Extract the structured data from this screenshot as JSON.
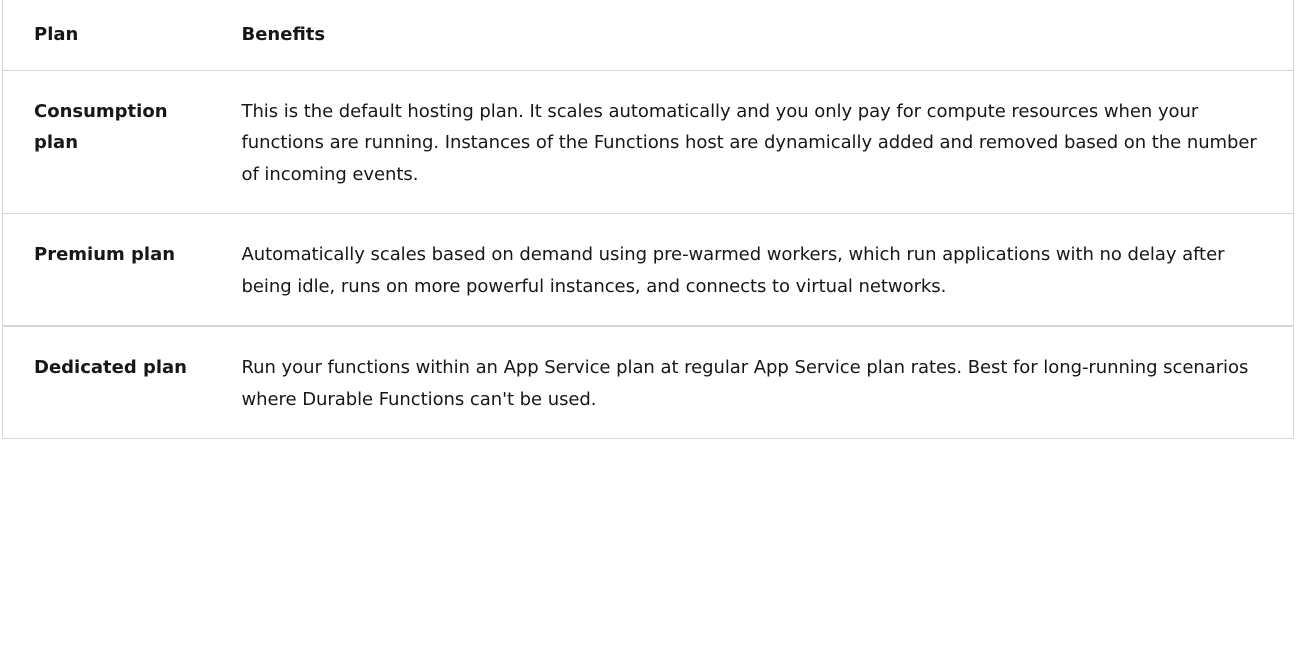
{
  "table": {
    "headers": {
      "plan": "Plan",
      "benefits": "Benefits"
    },
    "rows": [
      {
        "plan": "Consumption plan",
        "benefits": "This is the default hosting plan. It scales automatically and you only pay for compute resources when your functions are running. Instances of the Functions host are dynamically added and removed based on the number of incoming events."
      },
      {
        "plan": "Premium plan",
        "benefits": "Automatically scales based on demand using pre-warmed workers, which run applications with no delay after being idle, runs on more powerful instances, and connects to virtual networks."
      },
      {
        "plan": "Dedicated plan",
        "benefits": "Run your functions within an App Service plan at regular App Service plan rates. Best for long-running scenarios where Durable Functions can't be used."
      }
    ]
  }
}
